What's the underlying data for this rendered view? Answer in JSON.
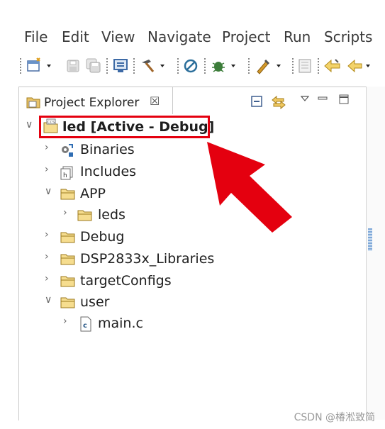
{
  "menubar": {
    "items": [
      "File",
      "Edit",
      "View",
      "Navigate",
      "Project",
      "Run",
      "Scripts"
    ]
  },
  "toolbar": {
    "icons": [
      "new-icon",
      "save-icon",
      "save-all-icon",
      "debug-view-icon",
      "build-icon",
      "no-entry-icon",
      "bug-debug-icon",
      "flash-tool-icon",
      "memory-icon",
      "back-icon",
      "forward-icon"
    ]
  },
  "panel": {
    "tab_title": "Project Explorer",
    "tab_close": "☒",
    "tree": [
      {
        "label": "led  [Active - Debug]",
        "expanded": true,
        "icon": "ccs-project-icon"
      },
      {
        "label": "Binaries",
        "expanded": false,
        "icon": "binaries-icon"
      },
      {
        "label": "Includes",
        "expanded": false,
        "icon": "includes-icon"
      },
      {
        "label": "APP",
        "expanded": true,
        "icon": "folder-icon"
      },
      {
        "label": "leds",
        "expanded": false,
        "icon": "folder-icon"
      },
      {
        "label": "Debug",
        "expanded": false,
        "icon": "folder-icon"
      },
      {
        "label": "DSP2833x_Libraries",
        "expanded": false,
        "icon": "folder-icon"
      },
      {
        "label": "targetConfigs",
        "expanded": false,
        "icon": "folder-icon"
      },
      {
        "label": "user",
        "expanded": true,
        "icon": "folder-icon"
      },
      {
        "label": "main.c",
        "expanded": false,
        "icon": "c-file-icon"
      }
    ]
  },
  "annotation": {
    "highlight_color": "#e4000f",
    "arrow_color": "#e4000f"
  },
  "watermark": "CSDN @椿淞致简"
}
